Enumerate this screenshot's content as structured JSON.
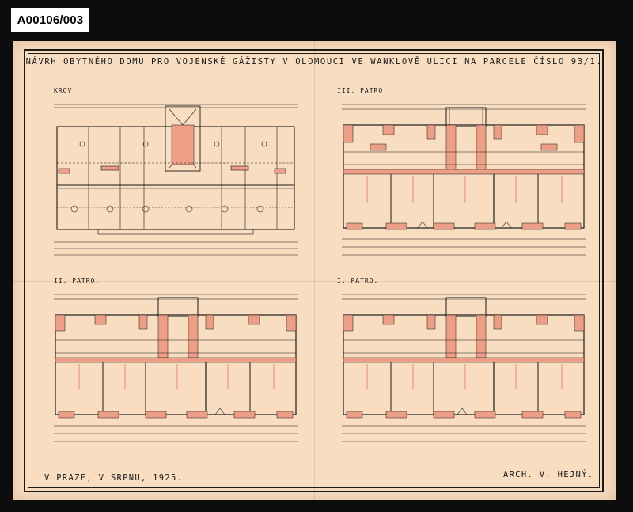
{
  "archive_id": "A00106/003",
  "sheet": {
    "title": "NÁVRH OBYTNÉHO DOMU PRO VOJENSKÉ GÁŽISTY V OLOMOUCI VE WANKLOVĚ ULICI NA PARCELE ČÍSLO 93/1.",
    "plans": [
      {
        "label": "KROV."
      },
      {
        "label": "III. PATRO."
      },
      {
        "label": "II. PATRO."
      },
      {
        "label": "I. PATRO."
      }
    ],
    "place_date": "V PRAZE, V SRPNU, 1925.",
    "architect": "ARCH. V. HEJNÝ."
  },
  "colors": {
    "paper": "#f8ddc0",
    "ink": "#1a1a1a",
    "wall_fill": "#ec9f86",
    "background": "#0d0d0d"
  }
}
